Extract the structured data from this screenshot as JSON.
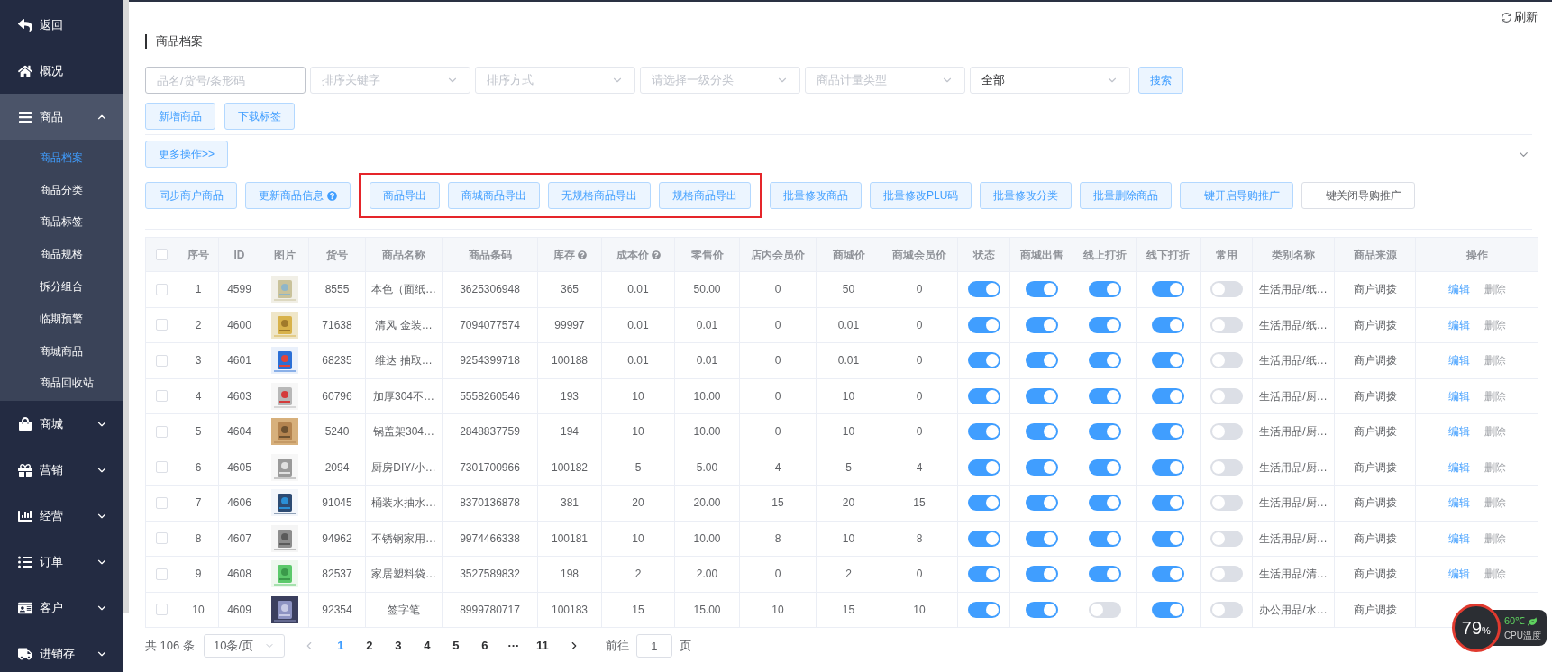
{
  "sidebar": {
    "items": [
      {
        "label": "返回"
      },
      {
        "label": "概况"
      },
      {
        "label": "商品",
        "expanded": true,
        "children": [
          {
            "label": "商品档案",
            "selected": true
          },
          {
            "label": "商品分类",
            "selected": false
          },
          {
            "label": "商品标签",
            "selected": false
          },
          {
            "label": "商品规格",
            "selected": false
          },
          {
            "label": "拆分组合",
            "selected": false
          },
          {
            "label": "临期预警",
            "selected": false
          },
          {
            "label": "商城商品",
            "selected": false
          },
          {
            "label": "商品回收站",
            "selected": false
          }
        ]
      },
      {
        "label": "商城",
        "expanded": false
      },
      {
        "label": "营销",
        "expanded": false
      },
      {
        "label": "经营",
        "expanded": false
      },
      {
        "label": "订单",
        "expanded": false
      },
      {
        "label": "客户",
        "expanded": false
      },
      {
        "label": "进销存",
        "expanded": false
      }
    ]
  },
  "refresh": "刷新",
  "page_title": "商品档案",
  "filters": [
    {
      "kind": "input",
      "placeholder": "品名/货号/条形码"
    },
    {
      "kind": "select",
      "placeholder": "排序关键字"
    },
    {
      "kind": "select",
      "placeholder": "排序方式"
    },
    {
      "kind": "select",
      "placeholder": "请选择一级分类"
    },
    {
      "kind": "select",
      "placeholder": "商品计量类型"
    },
    {
      "kind": "select",
      "value": "全部"
    }
  ],
  "search_button": "搜索",
  "top_buttons": [
    "新增商品",
    "下载标签"
  ],
  "more_button": "更多操作>>",
  "batch_groups": [
    {
      "kind": "plain",
      "buttons": [
        {
          "label": "同步商户商品",
          "kind": "light",
          "help": false
        },
        {
          "label": "更新商品信息",
          "kind": "light",
          "help": true
        }
      ]
    },
    {
      "kind": "framed",
      "buttons": [
        {
          "label": "商品导出",
          "kind": "light",
          "help": false
        },
        {
          "label": "商城商品导出",
          "kind": "light",
          "help": false
        },
        {
          "label": "无规格商品导出",
          "kind": "light",
          "help": false
        },
        {
          "label": "规格商品导出",
          "kind": "light",
          "help": false
        }
      ]
    },
    {
      "kind": "plain",
      "buttons": [
        {
          "label": "批量修改商品",
          "kind": "light",
          "help": false
        },
        {
          "label": "批量修改PLU码",
          "kind": "light",
          "help": false
        },
        {
          "label": "批量修改分类",
          "kind": "light",
          "help": false
        },
        {
          "label": "批量删除商品",
          "kind": "light",
          "help": false
        },
        {
          "label": "一键开启导购推广",
          "kind": "light",
          "help": false
        },
        {
          "label": "一键关闭导购推广",
          "kind": "plain",
          "help": false
        }
      ]
    }
  ],
  "table": {
    "select_all": {
      "checked": false
    },
    "columns": [
      {
        "label": "序号",
        "help": false
      },
      {
        "label": "ID",
        "help": false
      },
      {
        "label": "图片",
        "help": false
      },
      {
        "label": "货号",
        "help": false
      },
      {
        "label": "商品名称",
        "help": false
      },
      {
        "label": "商品条码",
        "help": false
      },
      {
        "label": "库存",
        "help": true
      },
      {
        "label": "成本价",
        "help": true
      },
      {
        "label": "零售价",
        "help": false
      },
      {
        "label": "店内会员价",
        "help": false
      },
      {
        "label": "商城价",
        "help": false
      },
      {
        "label": "商城会员价",
        "help": false
      },
      {
        "label": "状态",
        "help": false
      },
      {
        "label": "商城出售",
        "help": false
      },
      {
        "label": "线上打折",
        "help": false
      },
      {
        "label": "线下打折",
        "help": false
      },
      {
        "label": "常用",
        "help": false
      },
      {
        "label": "类别名称",
        "help": false
      },
      {
        "label": "商品来源",
        "help": false
      },
      {
        "label": "操作",
        "help": false
      }
    ],
    "rows": [
      {
        "checked": false,
        "no": "1",
        "id": "4599",
        "sku": "8555",
        "name": "本色（面纸…",
        "barcode": "3625306948",
        "stock": "365",
        "cost": "0.01",
        "retail": "50.00",
        "member": "0",
        "mall": "50",
        "mall_member": "0",
        "status": true,
        "mall_sale": true,
        "online_discount": true,
        "offline_discount": true,
        "common": false,
        "category": "生活用品/纸…",
        "source": "商户调拨",
        "actions": [
          "编辑",
          "删除"
        ]
      },
      {
        "checked": false,
        "no": "2",
        "id": "4600",
        "sku": "71638",
        "name": "清风 金装…",
        "barcode": "7094077574",
        "stock": "99997",
        "cost": "0.01",
        "retail": "0.01",
        "member": "0",
        "mall": "0.01",
        "mall_member": "0",
        "status": true,
        "mall_sale": true,
        "online_discount": true,
        "offline_discount": true,
        "common": false,
        "category": "生活用品/纸…",
        "source": "商户调拨",
        "actions": [
          "编辑",
          "删除"
        ]
      },
      {
        "checked": false,
        "no": "3",
        "id": "4601",
        "sku": "68235",
        "name": "维达 抽取…",
        "barcode": "9254399718",
        "stock": "100188",
        "cost": "0.01",
        "retail": "0.01",
        "member": "0",
        "mall": "0.01",
        "mall_member": "0",
        "status": true,
        "mall_sale": true,
        "online_discount": true,
        "offline_discount": true,
        "common": false,
        "category": "生活用品/纸…",
        "source": "商户调拨",
        "actions": [
          "编辑",
          "删除"
        ]
      },
      {
        "checked": false,
        "no": "4",
        "id": "4603",
        "sku": "60796",
        "name": "加厚304不…",
        "barcode": "5558260546",
        "stock": "193",
        "cost": "10",
        "retail": "10.00",
        "member": "0",
        "mall": "10",
        "mall_member": "0",
        "status": true,
        "mall_sale": true,
        "online_discount": true,
        "offline_discount": true,
        "common": false,
        "category": "生活用品/厨…",
        "source": "商户调拨",
        "actions": [
          "编辑",
          "删除"
        ]
      },
      {
        "checked": false,
        "no": "5",
        "id": "4604",
        "sku": "5240",
        "name": "锅盖架304…",
        "barcode": "2848837759",
        "stock": "194",
        "cost": "10",
        "retail": "10.00",
        "member": "0",
        "mall": "10",
        "mall_member": "0",
        "status": true,
        "mall_sale": true,
        "online_discount": true,
        "offline_discount": true,
        "common": false,
        "category": "生活用品/厨…",
        "source": "商户调拨",
        "actions": [
          "编辑",
          "删除"
        ]
      },
      {
        "checked": false,
        "no": "6",
        "id": "4605",
        "sku": "2094",
        "name": "厨房DIY/小…",
        "barcode": "7301700966",
        "stock": "100182",
        "cost": "5",
        "retail": "5.00",
        "member": "4",
        "mall": "5",
        "mall_member": "4",
        "status": true,
        "mall_sale": true,
        "online_discount": true,
        "offline_discount": true,
        "common": false,
        "category": "生活用品/厨…",
        "source": "商户调拨",
        "actions": [
          "编辑",
          "删除"
        ]
      },
      {
        "checked": false,
        "no": "7",
        "id": "4606",
        "sku": "91045",
        "name": "桶装水抽水…",
        "barcode": "8370136878",
        "stock": "381",
        "cost": "20",
        "retail": "20.00",
        "member": "15",
        "mall": "20",
        "mall_member": "15",
        "status": true,
        "mall_sale": true,
        "online_discount": true,
        "offline_discount": true,
        "common": false,
        "category": "生活用品/厨…",
        "source": "商户调拨",
        "actions": [
          "编辑",
          "删除"
        ]
      },
      {
        "checked": false,
        "no": "8",
        "id": "4607",
        "sku": "94962",
        "name": "不锈钢家用…",
        "barcode": "9974466338",
        "stock": "100181",
        "cost": "10",
        "retail": "10.00",
        "member": "8",
        "mall": "10",
        "mall_member": "8",
        "status": true,
        "mall_sale": true,
        "online_discount": true,
        "offline_discount": true,
        "common": false,
        "category": "生活用品/厨…",
        "source": "商户调拨",
        "actions": [
          "编辑",
          "删除"
        ]
      },
      {
        "checked": false,
        "no": "9",
        "id": "4608",
        "sku": "82537",
        "name": "家居塑料袋…",
        "barcode": "3527589832",
        "stock": "198",
        "cost": "2",
        "retail": "2.00",
        "member": "0",
        "mall": "2",
        "mall_member": "0",
        "status": true,
        "mall_sale": true,
        "online_discount": true,
        "offline_discount": true,
        "common": false,
        "category": "生活用品/清…",
        "source": "商户调拨",
        "actions": [
          "编辑",
          "删除"
        ]
      },
      {
        "checked": false,
        "no": "10",
        "id": "4609",
        "sku": "92354",
        "name": "签字笔",
        "barcode": "8999780717",
        "stock": "100183",
        "cost": "15",
        "retail": "15.00",
        "member": "10",
        "mall": "15",
        "mall_member": "10",
        "status": true,
        "mall_sale": true,
        "online_discount": false,
        "offline_discount": true,
        "common": false,
        "category": "办公用品/水…",
        "source": "商户调拨"
      }
    ]
  },
  "pagination": {
    "total": "共 106 条",
    "page_size": "10条/页",
    "pages": [
      {
        "label": "1",
        "selected": true
      },
      {
        "label": "2",
        "selected": false
      },
      {
        "label": "3",
        "selected": false
      },
      {
        "label": "4",
        "selected": false
      },
      {
        "label": "5",
        "selected": false
      },
      {
        "label": "6",
        "selected": false
      },
      {
        "label": "···",
        "selected": false
      },
      {
        "label": "11",
        "selected": false
      }
    ],
    "goto_label": "前往",
    "goto_value": "1",
    "goto_suffix": "页"
  },
  "cpu_widget": {
    "value": "79",
    "unit": "%",
    "temperature": "60℃",
    "label": "CPU温度"
  }
}
